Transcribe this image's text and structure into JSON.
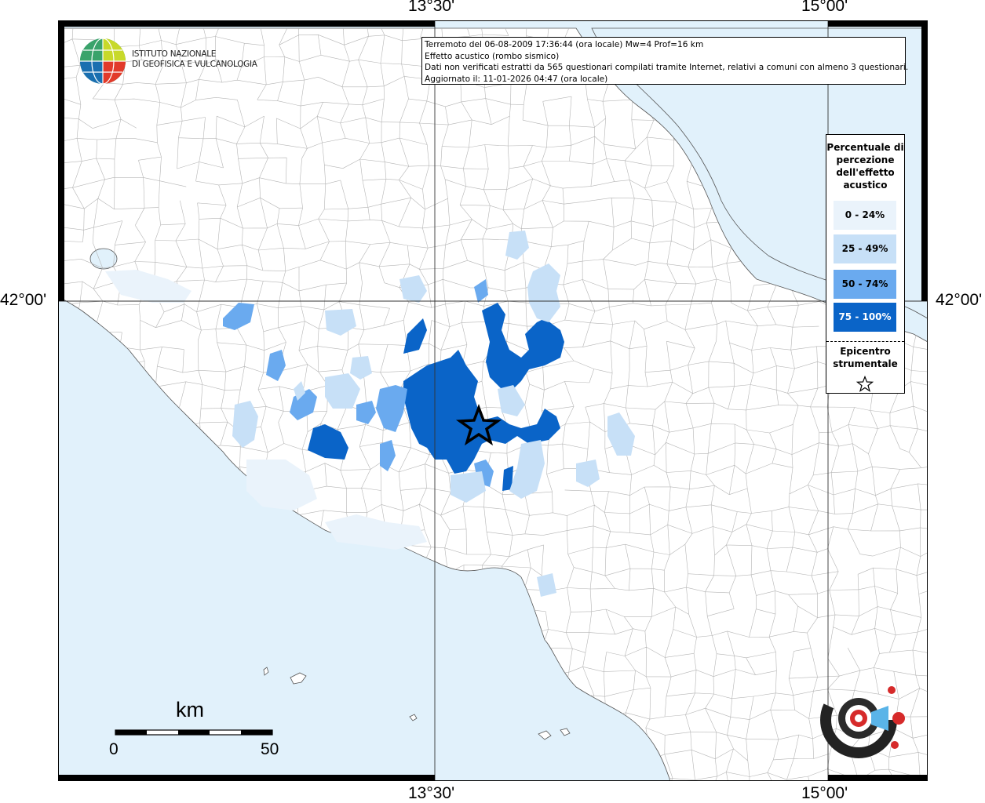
{
  "coords": {
    "top_1": "13°30'",
    "top_2": "15°00'",
    "bottom_1": "13°30'",
    "bottom_2": "15°00'",
    "left": "42°00'",
    "right": "42°00'"
  },
  "info": {
    "line1": "Terremoto del 06-08-2009 17:36:44 (ora locale) Mw=4 Prof=16 km",
    "line2": "Effetto acustico (rombo sismico)",
    "line3": "Dati non verificati estratti da 565 questionari compilati tramite Internet, relativi a comuni con almeno 3 questionari.",
    "line4": "Aggiornato il: 11-01-2026 04:47 (ora locale)"
  },
  "logo": {
    "line1": "ISTITUTO NAZIONALE",
    "line2": "DI GEOFISICA E VULCANOLOGIA"
  },
  "legend": {
    "title": "Percentuale di percezione dell'effetto acustico",
    "classes": [
      {
        "label": "0 - 24%",
        "color": "#eaf3fb"
      },
      {
        "label": "25 - 49%",
        "color": "#c7e0f7"
      },
      {
        "label": "50 - 74%",
        "color": "#6aaaef"
      },
      {
        "label": "75 - 100%",
        "color": "#0a64c8"
      }
    ],
    "epicenter_label": "Epicentro strumentale"
  },
  "scale": {
    "unit": "km",
    "min": "0",
    "max": "50"
  },
  "colors": {
    "sea": "#e1f1fb",
    "land": "#ffffff",
    "borders": "#aaaaaa"
  }
}
